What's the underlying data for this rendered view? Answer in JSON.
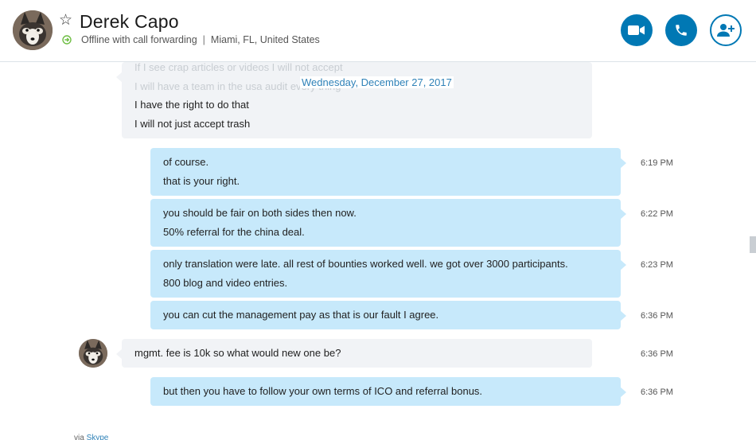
{
  "contact": {
    "name": "Derek Capo",
    "status": "Offline with call forwarding",
    "location": "Miami, FL, United States"
  },
  "conversation": {
    "faded_lines": [
      "If I see crap articles or videos I will not accept",
      "I will have a team in the usa audit every thing"
    ],
    "date_separator": "Wednesday, December 27, 2017",
    "top_partial_message": {
      "lines": [
        "I have the right to do that",
        "I will not just accept trash"
      ]
    },
    "messages": [
      {
        "direction": "out",
        "lines": [
          "of course.",
          "that is your right."
        ],
        "time": "6:19 PM"
      },
      {
        "direction": "out",
        "lines": [
          "you should be fair on both sides then now.",
          "50% referral for the china deal."
        ],
        "time": "6:22 PM"
      },
      {
        "direction": "out",
        "lines": [
          "only translation were late. all rest of bounties worked well. we got over 3000 participants.",
          "800 blog and video entries."
        ],
        "time": "6:23 PM"
      },
      {
        "direction": "out",
        "lines": [
          "you can cut the management pay as that is our fault I agree."
        ],
        "time": "6:36 PM"
      },
      {
        "direction": "in",
        "lines": [
          "mgmt. fee is 10k so what would new one be?"
        ],
        "time": "6:36 PM"
      },
      {
        "direction": "out",
        "lines": [
          "but then you have to follow your own terms of ICO and referral bonus."
        ],
        "time": "6:36 PM"
      }
    ]
  },
  "footer": {
    "via_prefix": "via",
    "via_link": "Skype"
  },
  "icons": {
    "favorite": "star-outline-icon",
    "forward": "call-forward-icon",
    "video": "video-camera-icon",
    "call": "phone-icon",
    "add": "add-person-icon"
  },
  "colors": {
    "accent": "#0078b4",
    "outgoing_bubble": "#c7e9fb",
    "incoming_bubble": "#f1f3f6",
    "date_text": "#2f82b8",
    "forward_icon": "#6fbe44"
  }
}
